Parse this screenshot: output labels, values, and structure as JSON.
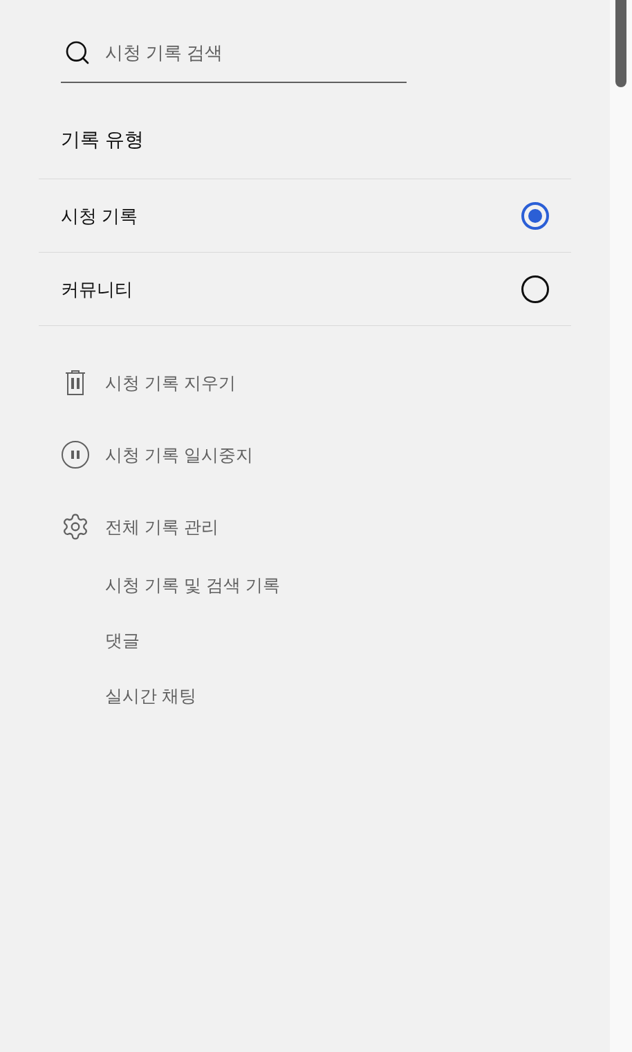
{
  "search": {
    "placeholder": "시청 기록 검색"
  },
  "history_type": {
    "title": "기록 유형",
    "options": [
      {
        "label": "시청 기록",
        "selected": true
      },
      {
        "label": "커뮤니티",
        "selected": false
      }
    ]
  },
  "actions": [
    {
      "kind": "clear",
      "label": "시청 기록 지우기"
    },
    {
      "kind": "pause",
      "label": "시청 기록 일시중지"
    },
    {
      "kind": "manage",
      "label": "전체 기록 관리"
    }
  ],
  "manage_links": [
    {
      "label": "시청 기록 및 검색 기록"
    },
    {
      "label": "댓글"
    },
    {
      "label": "실시간 채팅"
    }
  ]
}
